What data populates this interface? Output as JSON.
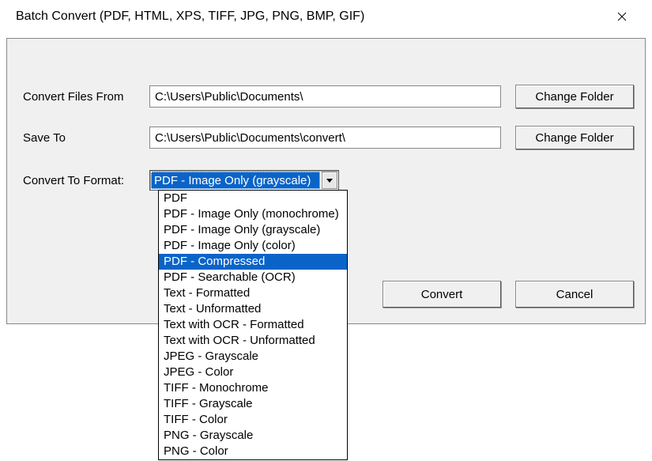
{
  "window": {
    "title": "Batch Convert (PDF, HTML, XPS, TIFF, JPG, PNG, BMP, GIF)"
  },
  "labels": {
    "convert_from": "Convert Files From",
    "save_to": "Save To",
    "convert_format": "Convert To Format:"
  },
  "fields": {
    "convert_from_value": "C:\\Users\\Public\\Documents\\",
    "save_to_value": "C:\\Users\\Public\\Documents\\convert\\",
    "format_selected": "PDF - Image Only (grayscale)"
  },
  "buttons": {
    "change_folder": "Change Folder",
    "convert": "Convert",
    "cancel": "Cancel"
  },
  "format_options": [
    "PDF",
    "PDF - Image Only (monochrome)",
    "PDF - Image Only (grayscale)",
    "PDF - Image Only (color)",
    "PDF - Compressed",
    "PDF - Searchable (OCR)",
    "Text - Formatted",
    "Text - Unformatted",
    "Text with OCR - Formatted",
    "Text with OCR - Unformatted",
    "JPEG - Grayscale",
    "JPEG - Color",
    "TIFF - Monochrome",
    "TIFF - Grayscale",
    "TIFF - Color",
    "PNG - Grayscale",
    "PNG - Color"
  ],
  "format_highlighted_index": 4
}
